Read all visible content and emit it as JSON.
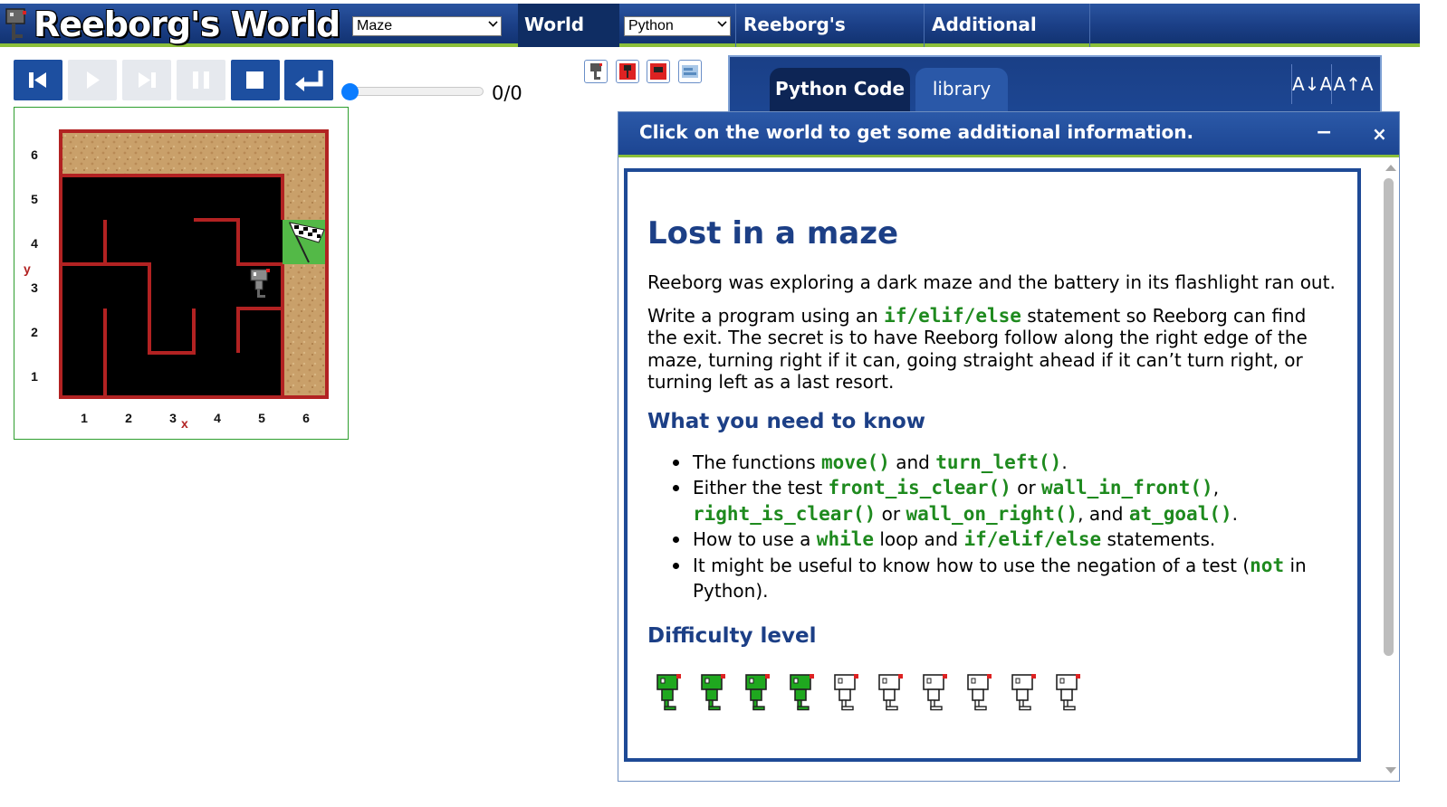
{
  "header": {
    "title": "Reeborg's World",
    "world_select": "Maze",
    "world_info": "World Info",
    "language_select": "Python",
    "keyboard": "Reeborg's keyboard",
    "options": "Additional options"
  },
  "controls": {
    "step_counter": "0/0",
    "slider_value": 0
  },
  "world": {
    "y_axis_label": "y",
    "x_axis_label": "x",
    "y_ticks": [
      "6",
      "5",
      "4",
      "3",
      "2",
      "1"
    ],
    "x_ticks": [
      "1",
      "2",
      "3",
      "4",
      "5",
      "6"
    ],
    "colors": {
      "wall": "#b22222",
      "floor": "#000000",
      "sand": "#c9a06a",
      "goal_grass": "#53b947"
    }
  },
  "editor": {
    "tabs": [
      "Python Code",
      "library"
    ],
    "font_decrease": "A↓A",
    "font_increase": "A↑A"
  },
  "dialog": {
    "title": "Click on the world to get some additional information.",
    "minimize": "−",
    "close": "×",
    "heading": "Lost in a maze",
    "intro": "Reeborg was exploring a dark maze and the battery in its flashlight ran out.",
    "p2_before": "Write a program using an ",
    "p2_code": "if/elif/else",
    "p2_after": " statement so Reeborg can find the exit. The secret is to have Reeborg follow along the right edge of the maze, turning right if it can, going straight ahead if it can’t turn right, or turning left as a last resort.",
    "need_heading": "What you need to know",
    "items": [
      {
        "a": "The functions ",
        "c1": "move()",
        "b": " and ",
        "c2": "turn_left()",
        "d": "."
      },
      {
        "a": "Either the test ",
        "c1": "front_is_clear()",
        "b": " or ",
        "c2": "wall_in_front()",
        "d": ", ",
        "c3": "right_is_clear()",
        "e": " or ",
        "c4": "wall_on_right()",
        "f": ", and ",
        "c5": "at_goal()",
        "g": "."
      },
      {
        "a": "How to use a ",
        "c1": "while",
        "b": " loop and ",
        "c2": "if/elif/else",
        "d": " statements."
      },
      {
        "a": "It might be useful to know how to use the negation of a test (",
        "c1": "not",
        "b": " in Python)."
      }
    ],
    "difficulty_heading": "Difficulty level",
    "difficulty": {
      "level": 4,
      "max": 10
    }
  }
}
